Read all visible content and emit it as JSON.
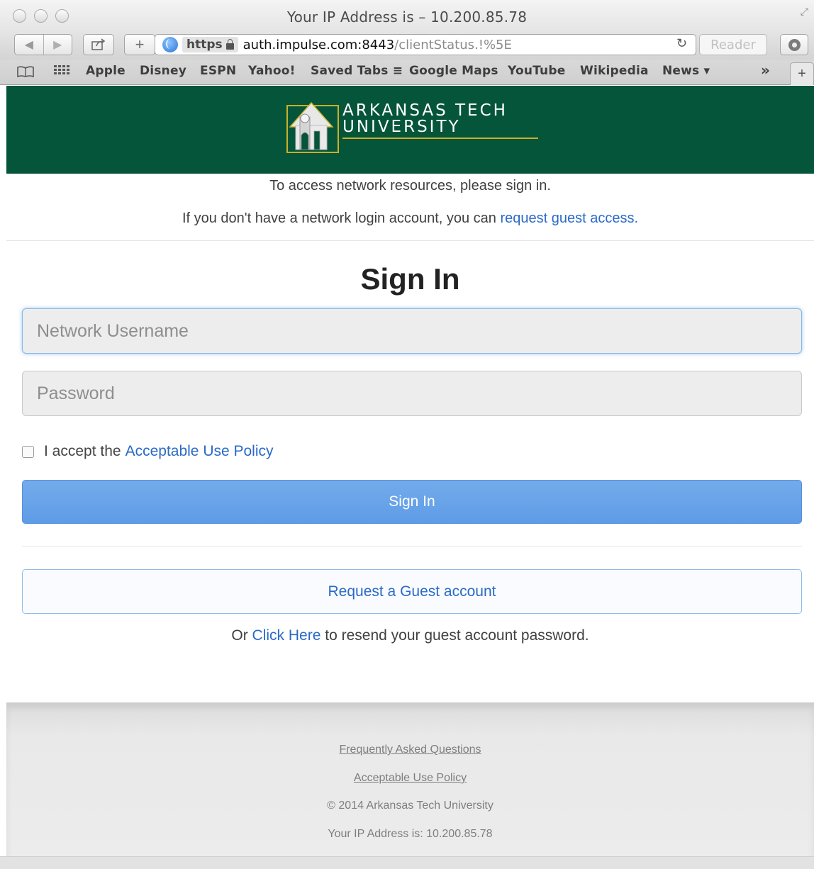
{
  "window": {
    "title": "Your IP Address is – 10.200.85.78"
  },
  "toolbar": {
    "scheme": "https",
    "url_host": "auth.impulse.com:8443",
    "url_path": "/clientStatus.!%5E",
    "reader_label": "Reader",
    "add_label": "+",
    "reload_glyph": "↻"
  },
  "bookmarks": {
    "items": [
      "Apple",
      "Disney",
      "ESPN",
      "Yahoo!",
      "Saved Tabs ≡",
      "Google Maps",
      "YouTube",
      "Wikipedia",
      "News ▾"
    ],
    "overflow_glyph": "»",
    "new_tab_glyph": "+"
  },
  "header": {
    "logo_line1": "ARKANSAS TECH",
    "logo_line2": "UNIVERSITY",
    "brand_color": "#04553a",
    "accent_color": "#c9b02a"
  },
  "intro": {
    "line1": "To access network resources, please sign in.",
    "line2_prefix": "If you don't have a network login account, you can ",
    "line2_link": "request guest access."
  },
  "signin": {
    "title": "Sign In",
    "username_placeholder": "Network Username",
    "password_placeholder": "Password",
    "accept_prefix": "I accept the",
    "accept_link": "Acceptable Use Policy",
    "submit_label": "Sign In",
    "guest_button": "Request a Guest account",
    "resend_prefix": "Or ",
    "resend_link": "Click Here",
    "resend_suffix": " to resend your guest account password."
  },
  "footer": {
    "faq": "Frequently Asked Questions",
    "aup": "Acceptable Use Policy",
    "copyright": "© 2014 Arkansas Tech University",
    "ip": "Your IP Address is: 10.200.85.78"
  }
}
